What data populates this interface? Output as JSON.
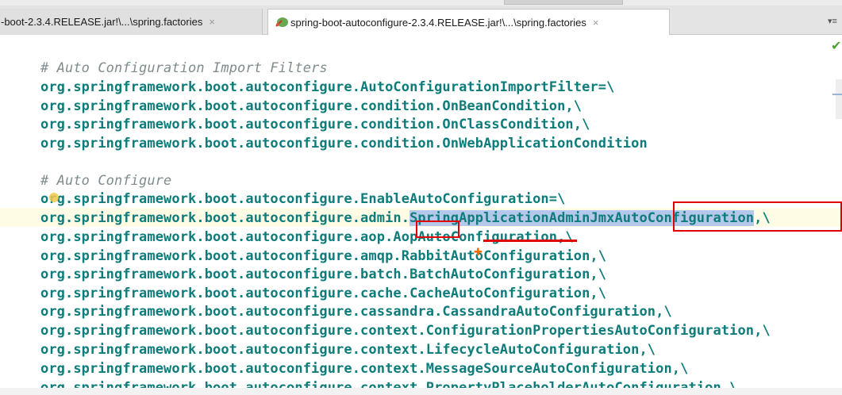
{
  "tabs": [
    {
      "label": "-boot-2.3.4.RELEASE.jar!\\...\\spring.factories",
      "close": "×",
      "active": false
    },
    {
      "label": "spring-boot-autoconfigure-2.3.4.RELEASE.jar!\\...\\spring.factories",
      "close": "×",
      "active": true
    }
  ],
  "tab_menu": "▾≡",
  "editor": {
    "status_icon": "check-icon",
    "lines": [
      {
        "text": "# Auto Configuration Import Filters",
        "type": "comment"
      },
      {
        "text": "org.springframework.boot.autoconfigure.AutoConfigurationImportFilter=\\",
        "type": "code"
      },
      {
        "text": "org.springframework.boot.autoconfigure.condition.OnBeanCondition,\\",
        "type": "code"
      },
      {
        "text": "org.springframework.boot.autoconfigure.condition.OnClassCondition,\\",
        "type": "code"
      },
      {
        "text": "org.springframework.boot.autoconfigure.condition.OnWebApplicationCondition",
        "type": "code"
      },
      {
        "text": "",
        "type": "blank"
      },
      {
        "text": "# Auto Configure",
        "type": "comment"
      },
      {
        "text": "org.springframework.boot.autoconfigure.EnableAutoConfiguration=\\",
        "type": "code"
      },
      {
        "text_pre": "org.springframework.boot.autoconfigure.admin.",
        "text_sel": "SpringApplicationAdminJmxAutoConfiguration",
        "text_post": ",\\",
        "type": "code"
      },
      {
        "text": "org.springframework.boot.autoconfigure.aop.AopAutoConfiguration,\\",
        "type": "code"
      },
      {
        "text": "org.springframework.boot.autoconfigure.amqp.RabbitAutoConfiguration,\\",
        "type": "code"
      },
      {
        "text": "org.springframework.boot.autoconfigure.batch.BatchAutoConfiguration,\\",
        "type": "code"
      },
      {
        "text": "org.springframework.boot.autoconfigure.cache.CacheAutoConfiguration,\\",
        "type": "code"
      },
      {
        "text": "org.springframework.boot.autoconfigure.cassandra.CassandraAutoConfiguration,\\",
        "type": "code"
      },
      {
        "text": "org.springframework.boot.autoconfigure.context.ConfigurationPropertiesAutoConfiguration,\\",
        "type": "code"
      },
      {
        "text": "org.springframework.boot.autoconfigure.context.LifecycleAutoConfiguration,\\",
        "type": "code"
      },
      {
        "text": "org.springframework.boot.autoconfigure.context.MessageSourceAutoConfiguration,\\",
        "type": "code"
      },
      {
        "text": "org.springframework.boot.autoconfigure.context.PropertyPlaceholderAutoConfiguration,\\",
        "type": "code"
      }
    ]
  },
  "colors": {
    "code": "#0d7c7a",
    "comment": "#7f8c8d",
    "selection": "#b4c8ec",
    "annotation_red": "#e00000",
    "current_line": "#fffce6"
  }
}
